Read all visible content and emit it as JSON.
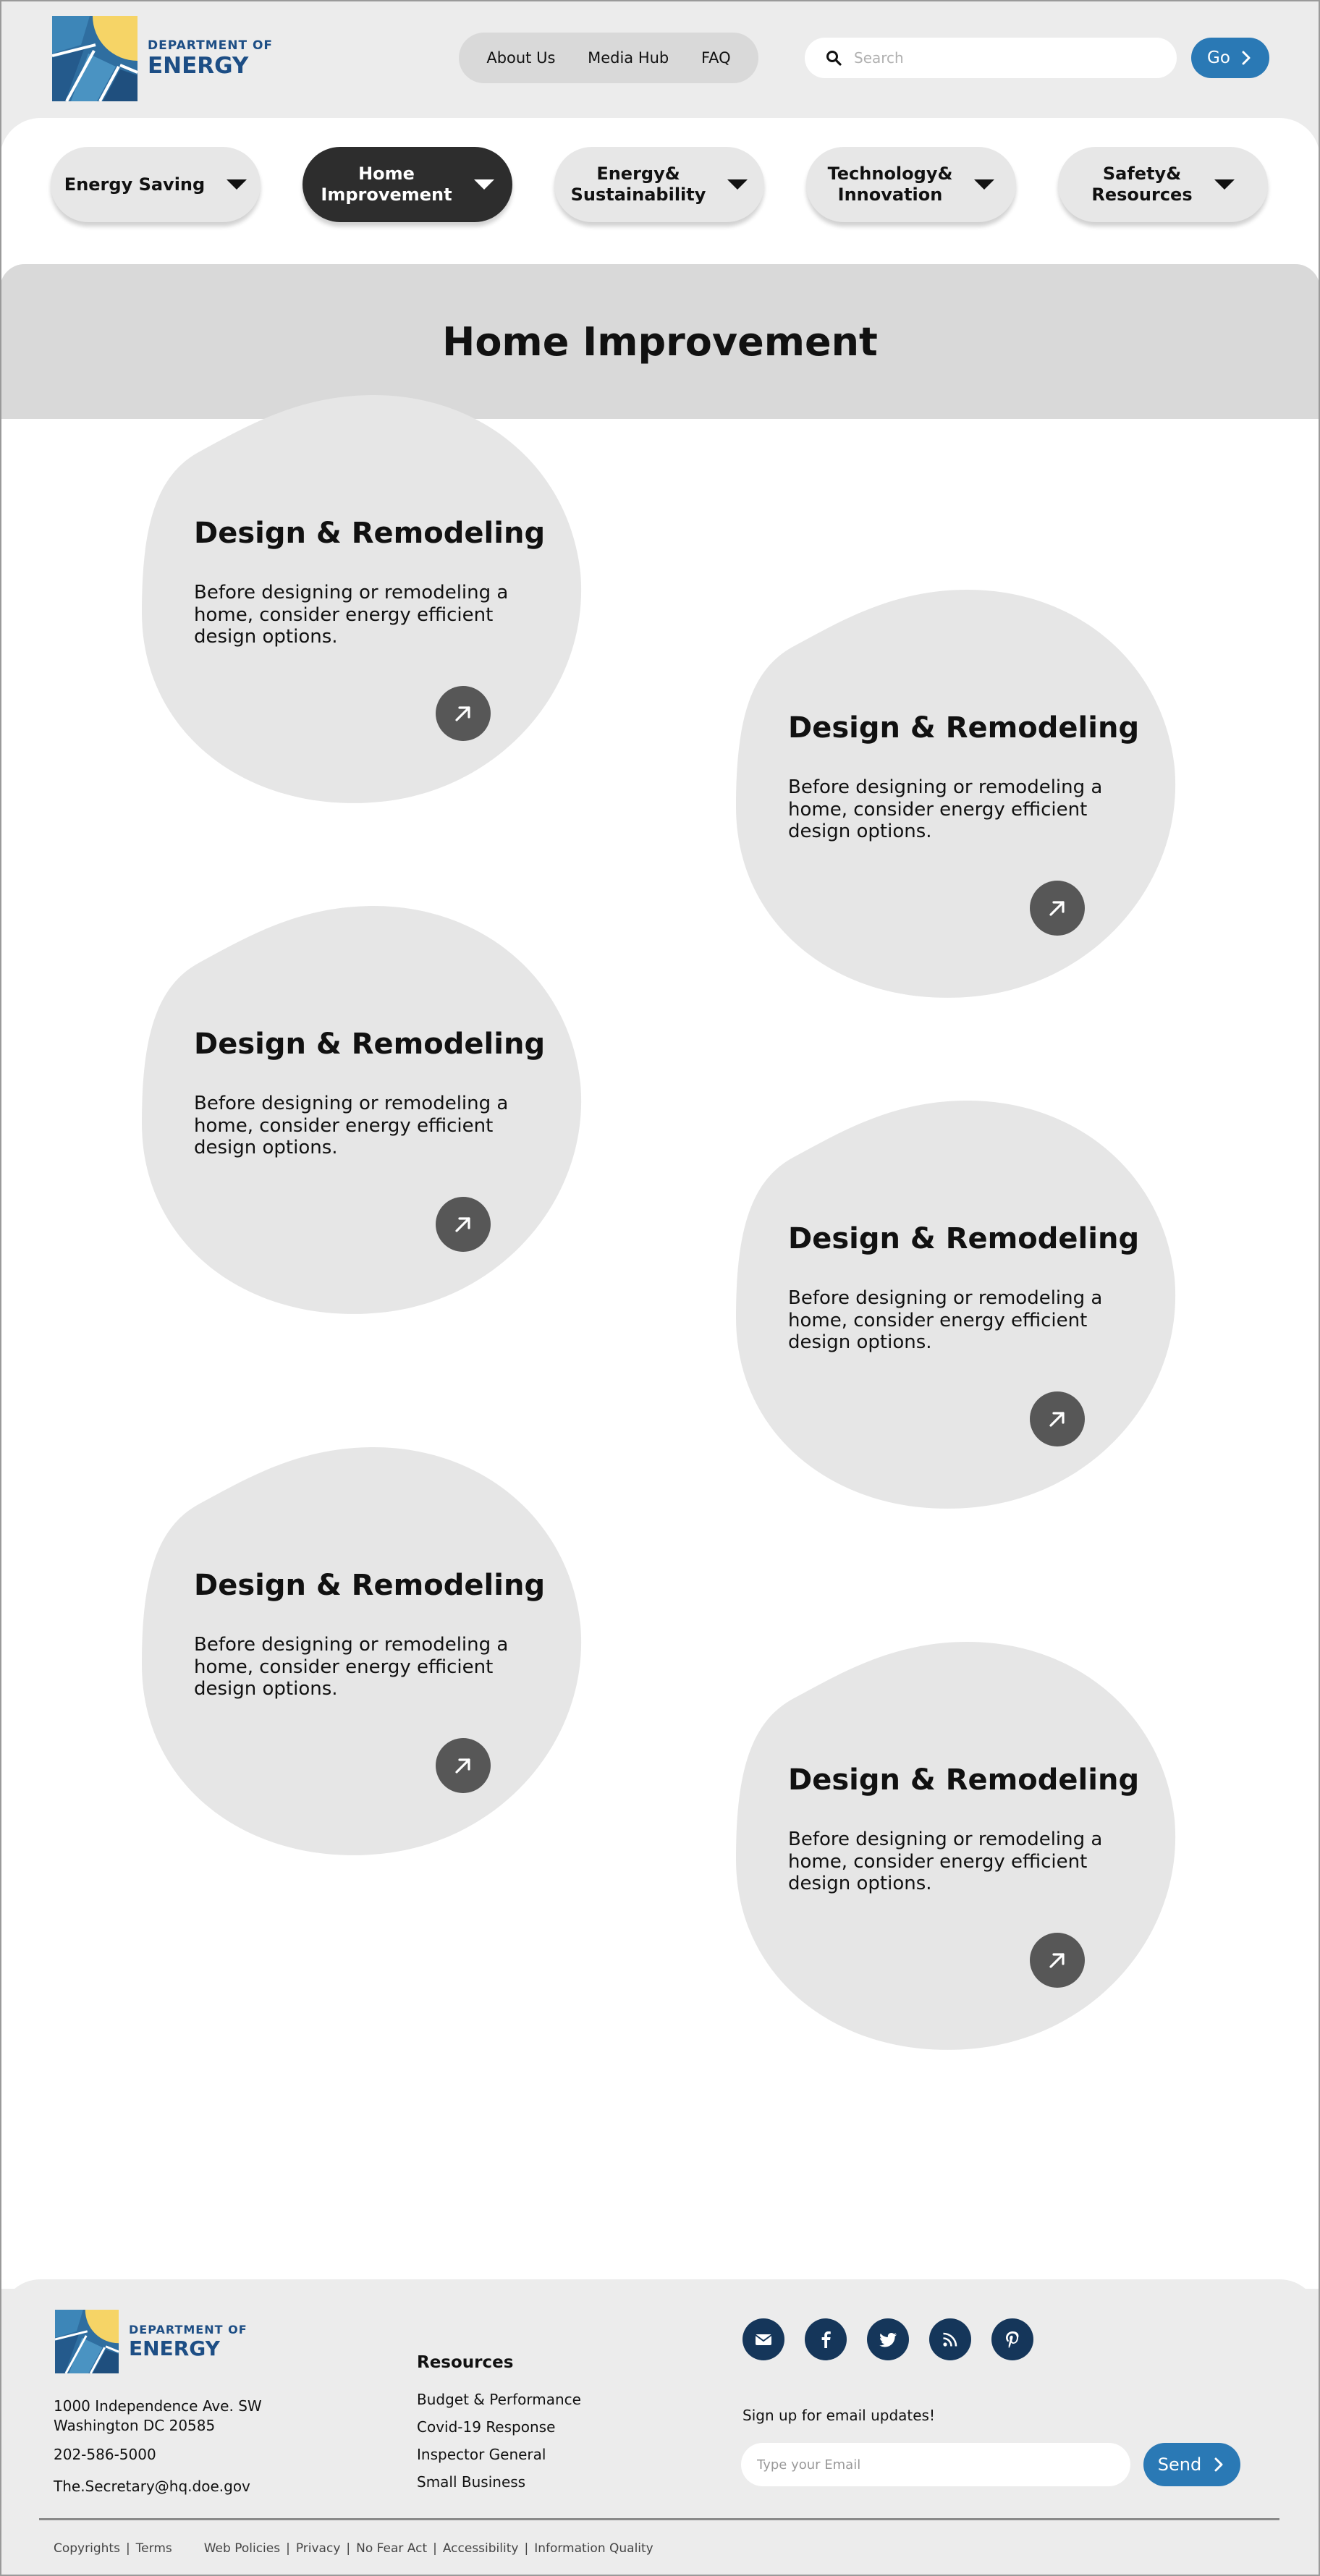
{
  "header": {
    "logo": {
      "line1": "DEPARTMENT OF",
      "line2": "ENERGY"
    },
    "nav": [
      "About Us",
      "Media Hub",
      "FAQ"
    ],
    "search_placeholder": "Search",
    "go_label": "Go"
  },
  "categories": [
    {
      "label": "Energy Saving",
      "active": false
    },
    {
      "label": "Home\nImprovement",
      "active": true
    },
    {
      "label": "Energy&\nSustainability",
      "active": false
    },
    {
      "label": "Technology&\nInnovation",
      "active": false
    },
    {
      "label": "Safety&\nResources",
      "active": false
    }
  ],
  "page_title": "Home Improvement",
  "cards": [
    {
      "title": "Design & Remodeling",
      "description": "Before designing or remodeling a home, consider energy efficient design options."
    },
    {
      "title": "Design & Remodeling",
      "description": "Before designing or remodeling a home, consider energy efficient design options."
    },
    {
      "title": "Design & Remodeling",
      "description": "Before designing or remodeling a home, consider energy efficient design options."
    },
    {
      "title": "Design & Remodeling",
      "description": "Before designing or remodeling a home, consider energy efficient design options."
    },
    {
      "title": "Design & Remodeling",
      "description": "Before designing or remodeling a home, consider energy efficient design options."
    },
    {
      "title": "Design & Remodeling",
      "description": "Before designing or remodeling a home, consider energy efficient design options."
    }
  ],
  "footer": {
    "logo": {
      "line1": "DEPARTMENT OF",
      "line2": "ENERGY"
    },
    "address_line1": "1000 Independence Ave. SW",
    "address_line2": "Washington DC 20585",
    "phone": "202-586-5000",
    "email": "The.Secretary@hq.doe.gov",
    "resources_title": "Resources",
    "resources": [
      "Budget & Performance",
      "Covid-19 Response",
      "Inspector General",
      "Small Business"
    ],
    "socials": [
      "envelope-icon",
      "facebook-icon",
      "twitter-icon",
      "rss-icon",
      "pinterest-icon"
    ],
    "signup_text": "Sign up for email updates!",
    "email_placeholder": "Type your Email",
    "send_label": "Send",
    "legal_left": [
      "Copyrights",
      "Terms"
    ],
    "legal_right": [
      "Web Policies",
      "Privacy",
      "No Fear Act",
      "Accessibility",
      "Information Quality"
    ]
  },
  "colors": {
    "brand_blue": "#2a79b5",
    "logo_navy": "#1d4e85",
    "logo_yellow": "#f6d466",
    "active_tab": "#2d2d2d",
    "social_bg": "#15365a"
  }
}
